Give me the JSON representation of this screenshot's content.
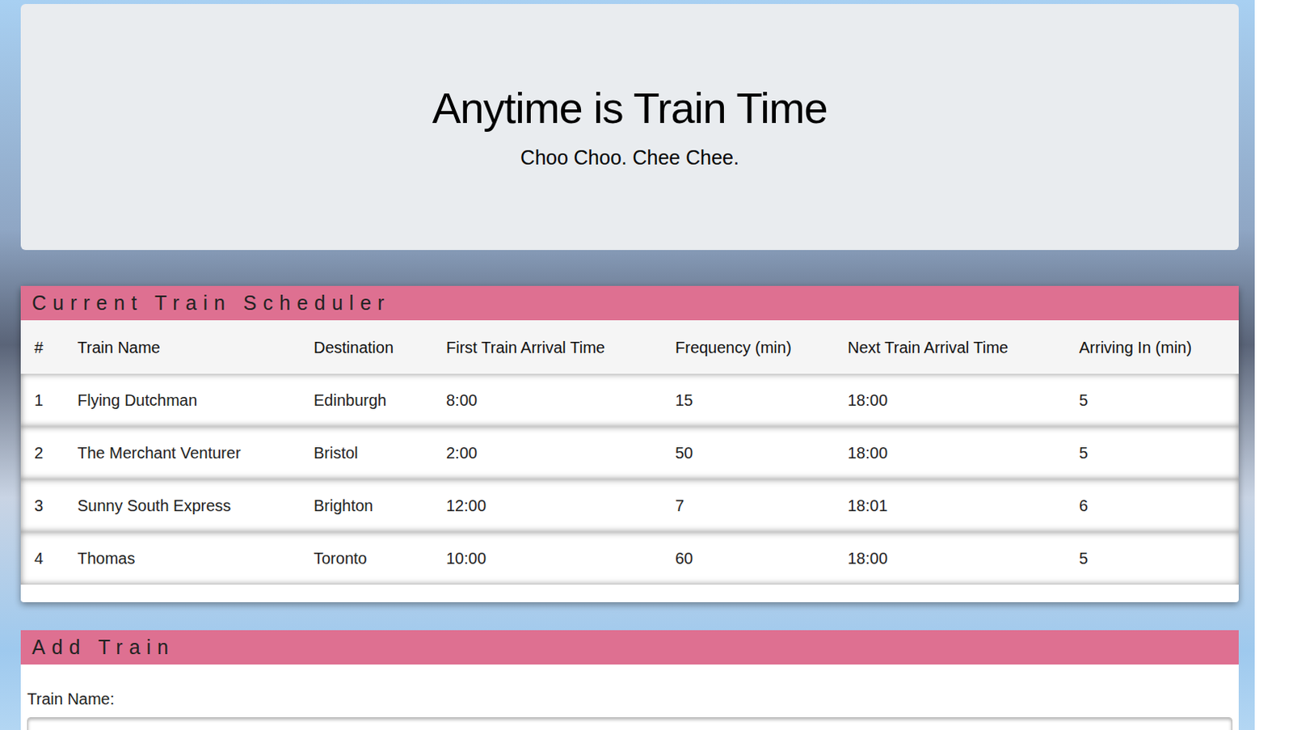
{
  "jumbotron": {
    "title": "Anytime is Train Time",
    "subtitle": "Choo Choo. Chee Chee."
  },
  "schedule": {
    "title": "Current Train Scheduler",
    "columns": [
      "#",
      "Train Name",
      "Destination",
      "First Train Arrival Time",
      "Frequency (min)",
      "Next Train Arrival Time",
      "Arriving In (min)"
    ],
    "rows": [
      [
        "1",
        "Flying Dutchman",
        "Edinburgh",
        "8:00",
        "15",
        "18:00",
        "5"
      ],
      [
        "2",
        "The Merchant Venturer",
        "Bristol",
        "2:00",
        "50",
        "18:00",
        "5"
      ],
      [
        "3",
        "Sunny South Express",
        "Brighton",
        "12:00",
        "7",
        "18:01",
        "6"
      ],
      [
        "4",
        "Thomas",
        "Toronto",
        "10:00",
        "60",
        "18:00",
        "5"
      ]
    ]
  },
  "add_train": {
    "title": "Add Train",
    "fields": [
      {
        "label": "Train Name:",
        "value": ""
      }
    ]
  }
}
